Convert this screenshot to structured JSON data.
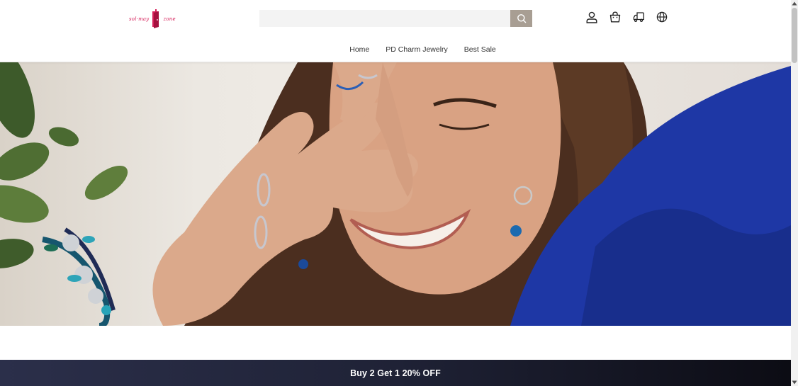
{
  "brand": {
    "logo_left": "sol·may",
    "logo_right": "zone",
    "accent_color": "#d6205a"
  },
  "search": {
    "placeholder": "",
    "button_icon": "search-icon",
    "button_color": "#a89e93"
  },
  "header_icons": [
    "account-icon",
    "cart-icon",
    "shipping-truck-icon",
    "globe-icon"
  ],
  "nav": {
    "items": [
      {
        "label": "Home"
      },
      {
        "label": "PD Charm Jewelry"
      },
      {
        "label": "Best Sale"
      }
    ]
  },
  "hero": {
    "image": "model-wearing-charm-bracelet-rings-earrings"
  },
  "promo": {
    "text": "Buy 2 Get 1 20% OFF",
    "background": "#1f2236"
  }
}
